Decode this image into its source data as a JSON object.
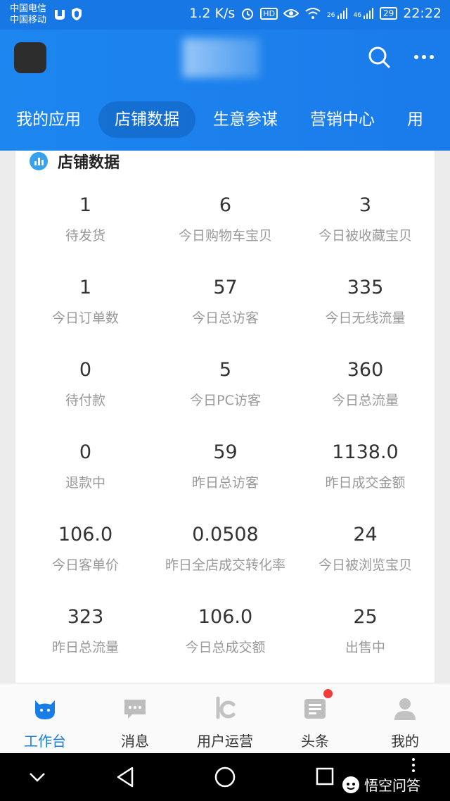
{
  "status_bar": {
    "carrier_1": "中国电信",
    "carrier_2": "中国移动",
    "net_speed": "1.2 K/s",
    "hd": "HD",
    "signal_1": "26",
    "signal_2": "46",
    "battery": "29",
    "time": "22:22"
  },
  "header": {
    "tabs": [
      {
        "label": "我的应用"
      },
      {
        "label": "店铺数据",
        "active": true
      },
      {
        "label": "生意参谋"
      },
      {
        "label": "营销中心"
      },
      {
        "label": "用"
      }
    ]
  },
  "card": {
    "title": "店铺数据",
    "stats": [
      {
        "value": "1",
        "label": "待发货"
      },
      {
        "value": "6",
        "label": "今日购物车宝贝"
      },
      {
        "value": "3",
        "label": "今日被收藏宝贝"
      },
      {
        "value": "1",
        "label": "今日订单数"
      },
      {
        "value": "57",
        "label": "今日总访客"
      },
      {
        "value": "335",
        "label": "今日无线流量"
      },
      {
        "value": "0",
        "label": "待付款"
      },
      {
        "value": "5",
        "label": "今日PC访客"
      },
      {
        "value": "360",
        "label": "今日总流量"
      },
      {
        "value": "0",
        "label": "退款中"
      },
      {
        "value": "59",
        "label": "昨日总访客"
      },
      {
        "value": "1138.0",
        "label": "昨日成交金额"
      },
      {
        "value": "106.0",
        "label": "今日客单价"
      },
      {
        "value": "0.0508",
        "label": "昨日全店成交转化率"
      },
      {
        "value": "24",
        "label": "今日被浏览宝贝"
      },
      {
        "value": "323",
        "label": "昨日总流量"
      },
      {
        "value": "106.0",
        "label": "今日总成交额"
      },
      {
        "value": "25",
        "label": "出售中"
      }
    ]
  },
  "tab_bar": {
    "items": [
      {
        "label": "工作台",
        "icon": "workbench-icon",
        "active": true
      },
      {
        "label": "消息",
        "icon": "message-icon"
      },
      {
        "label": "用户运营",
        "icon": "user-ops-icon"
      },
      {
        "label": "头条",
        "icon": "headlines-icon",
        "badge": true
      },
      {
        "label": "我的",
        "icon": "profile-icon"
      }
    ]
  },
  "watermark": "悟空问答",
  "colors": {
    "brand_blue": "#1a7bea",
    "active_tab": "#1a7de6",
    "badge_red": "#f23b3b",
    "title_icon": "#39a0ee"
  }
}
